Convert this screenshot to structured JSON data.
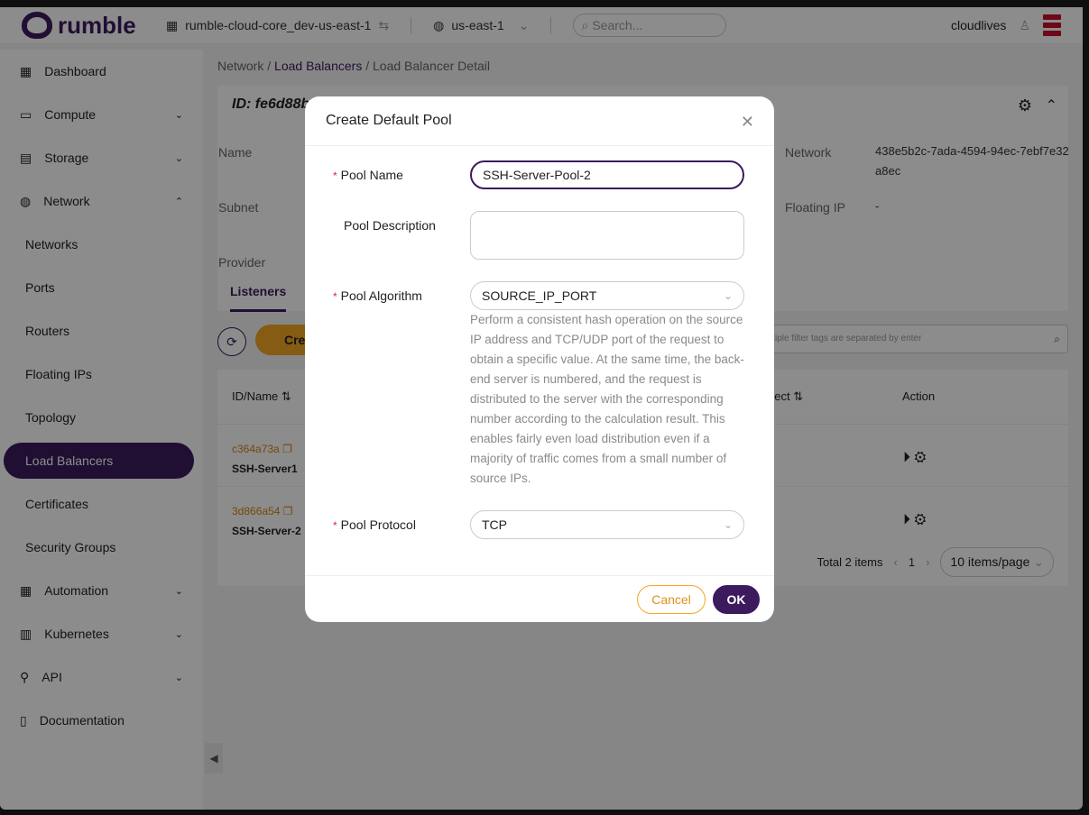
{
  "header": {
    "brand": "rumble",
    "project": "rumble-cloud-core_dev-us-east-1",
    "region": "us-east-1",
    "search_placeholder": "Search...",
    "user": "cloudlives"
  },
  "sidebar": {
    "items": [
      {
        "label": "Dashboard",
        "icon": "grid-icon",
        "top": true
      },
      {
        "label": "Compute",
        "icon": "monitor-icon",
        "top": true,
        "chevron": "⌄"
      },
      {
        "label": "Storage",
        "icon": "storage-icon",
        "top": true,
        "chevron": "⌄"
      },
      {
        "label": "Network",
        "icon": "globe-icon",
        "top": true,
        "chevron": "⌃"
      },
      {
        "label": "Networks"
      },
      {
        "label": "Ports"
      },
      {
        "label": "Routers"
      },
      {
        "label": "Floating IPs"
      },
      {
        "label": "Topology"
      },
      {
        "label": "Load Balancers",
        "active": true
      },
      {
        "label": "Certificates"
      },
      {
        "label": "Security Groups"
      },
      {
        "label": "Automation",
        "icon": "grid-icon",
        "top": true,
        "chevron": "⌄"
      },
      {
        "label": "Kubernetes",
        "icon": "document-icon",
        "top": true,
        "chevron": "⌄"
      },
      {
        "label": "API",
        "icon": "plug-icon",
        "top": true,
        "chevron": "⌄"
      },
      {
        "label": "Documentation",
        "icon": "book-icon",
        "top": true
      }
    ]
  },
  "breadcrumb": {
    "root": "Network",
    "parent": "Load Balancers",
    "current": "Load Balancer Detail"
  },
  "detail": {
    "id": "ID: fe6d88b8-",
    "name_label": "Name",
    "subnet_label": "Subnet",
    "provider_label": "Provider",
    "network_label": "Network",
    "network_value": "438e5b2c-7ada-4594-94ec-7ebf7e32a8ec",
    "floating_label": "Floating IP",
    "floating_value": "-"
  },
  "tabs": {
    "listeners": "Listeners"
  },
  "toolbar": {
    "create": "Cre",
    "filter_placeholder": "ltiple filter tags are separated by enter"
  },
  "table": {
    "col_id": "ID/Name",
    "col_connect": "nect",
    "col_action": "Action",
    "rows": [
      {
        "id": "c364a73a",
        "name": "SSH-Server1"
      },
      {
        "id": "3d866a54",
        "name": "SSH-Server-2"
      }
    ]
  },
  "pager": {
    "total": "Total 2 items",
    "page": "1",
    "size": "10 items/page"
  },
  "modal": {
    "title": "Create Default Pool",
    "pool_name_label": "Pool Name",
    "pool_name_value": "SSH-Server-Pool-2",
    "pool_desc_label": "Pool Description",
    "pool_algo_label": "Pool Algorithm",
    "pool_algo_value": "SOURCE_IP_PORT",
    "pool_algo_help": "Perform a consistent hash operation on the source IP address and TCP/UDP port of the request to obtain a specific value. At the same time, the back-end server is numbered, and the request is distributed to the server with the corresponding number according to the calculation result. This enables fairly even load distribution even if a majority of traffic comes from a small number of source IPs.",
    "pool_protocol_label": "Pool Protocol",
    "pool_protocol_value": "TCP",
    "cancel": "Cancel",
    "ok": "OK"
  },
  "colors": {
    "brand": "#3b1a5e",
    "accent": "#f5a623",
    "required": "#e0253f"
  }
}
